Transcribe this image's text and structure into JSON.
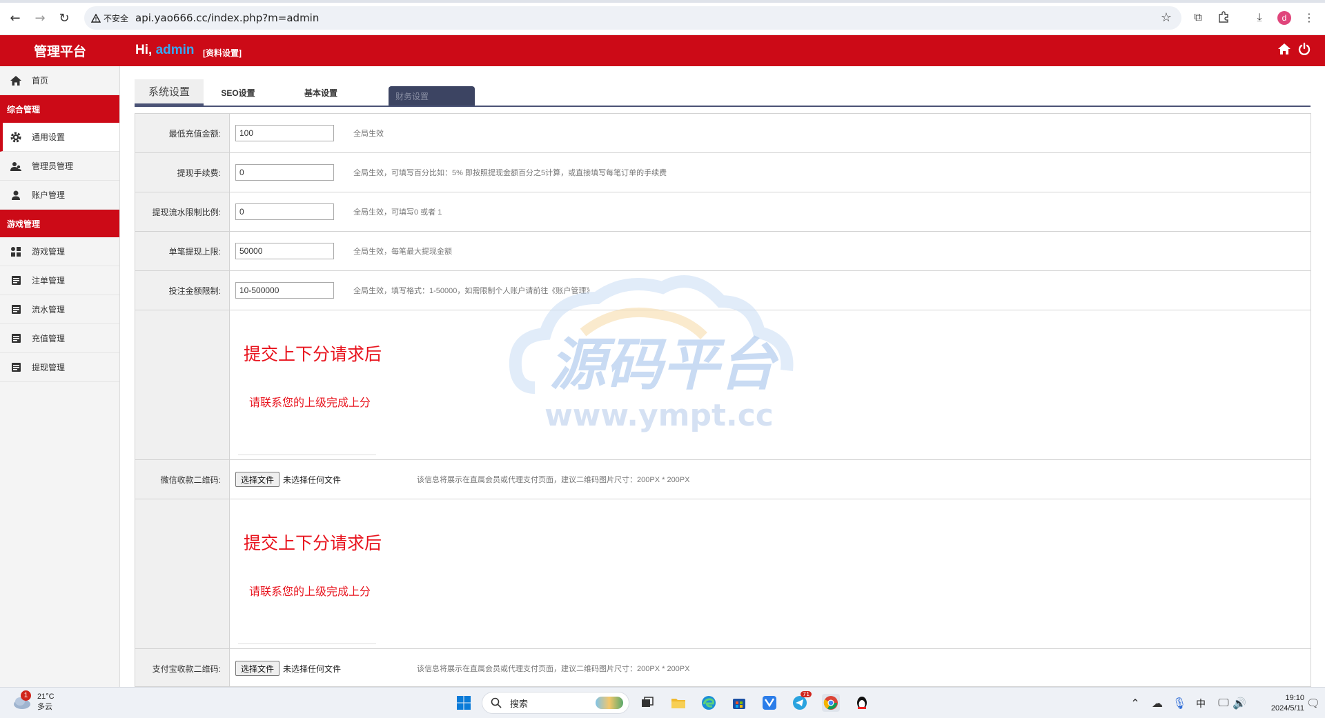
{
  "browser": {
    "security_label": "不安全",
    "url": "api.yao666.cc/index.php?m=admin",
    "profile_initial": "d"
  },
  "header": {
    "brand": "管理平台",
    "greeting": "Hi,",
    "username": "admin",
    "profile_link": "[资料设置]"
  },
  "sidebar": {
    "home": "首页",
    "section_general": "综合管理",
    "general_items": [
      "通用设置",
      "管理员管理",
      "账户管理"
    ],
    "section_game": "游戏管理",
    "game_items": [
      "游戏管理",
      "注单管理",
      "流水管理",
      "充值管理",
      "提现管理"
    ]
  },
  "tabs": [
    "系统设置",
    "SEO设置",
    "基本设置",
    "财务设置"
  ],
  "form": {
    "rows": [
      {
        "label": "最低充值金额:",
        "value": "100",
        "hint": "全局生效"
      },
      {
        "label": "提现手续费:",
        "value": "0",
        "hint": "全局生效，可填写百分比如：5% 即按照提现金额百分之5计算，或直接填写每笔订单的手续费"
      },
      {
        "label": "提现流水限制比例:",
        "value": "0",
        "hint": "全局生效，可填写0 或者 1"
      },
      {
        "label": "单笔提现上限:",
        "value": "50000",
        "hint": "全局生效，每笔最大提现金额"
      },
      {
        "label": "投注金额限制:",
        "value": "10-500000",
        "hint": "全局生效，填写格式：1-50000，如需限制个人账户请前往《账户管理》"
      }
    ],
    "notice_title": "提交上下分请求后",
    "notice_sub": "请联系您的上级完成上分",
    "wechat_label": "微信收款二维码:",
    "alipay_label": "支付宝收款二维码:",
    "file_button": "选择文件",
    "file_status": "未选择任何文件",
    "upload_hint": "该信息将展示在直属会员或代理支付页面，建议二维码图片尺寸：200PX * 200PX"
  },
  "watermark": {
    "title": "源码平台",
    "url": "www.ympt.cc"
  },
  "taskbar": {
    "weather_temp": "21°C",
    "weather_desc": "多云",
    "weather_badge": "1",
    "search_placeholder": "搜索",
    "ime": "中",
    "time": "19:10",
    "date": "2024/5/11",
    "app_badge": "71"
  },
  "colors": {
    "primary_red": "#cc0a17",
    "tab_dark": "#3c4462",
    "notice_red": "#e8141e",
    "accent_blue": "#35a9f5"
  }
}
